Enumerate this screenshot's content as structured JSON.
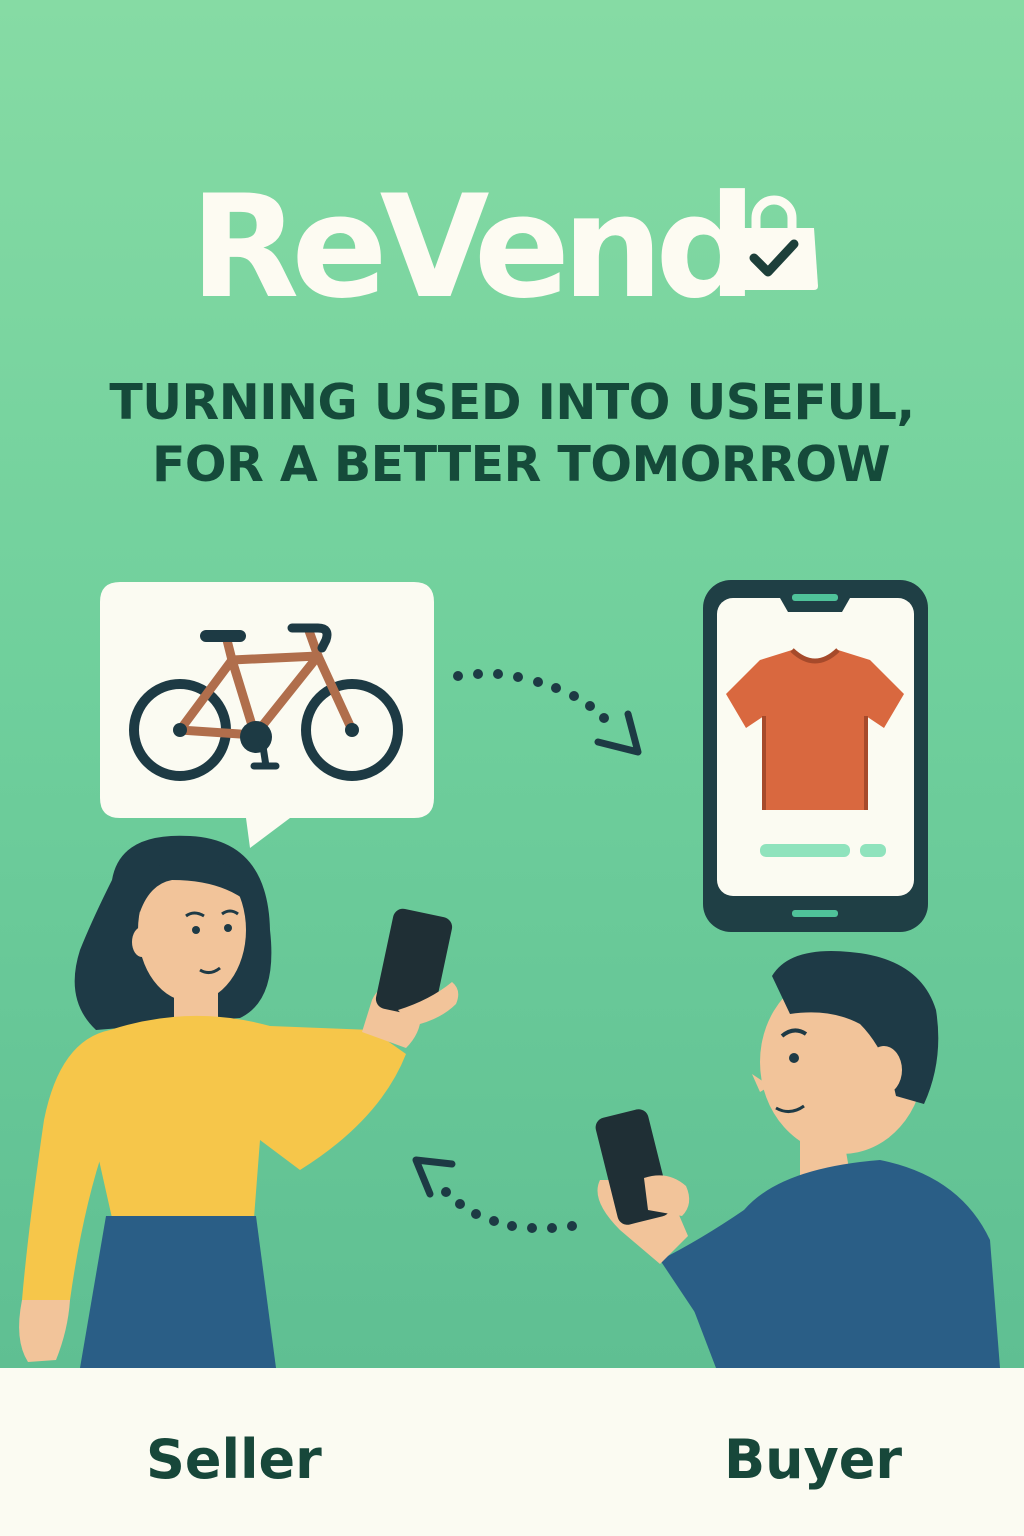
{
  "brand": {
    "name": "ReVend",
    "logo_icon": "shopping-bag-check-icon"
  },
  "tagline": {
    "line1": "TURNING USED INTO USEFUL,",
    "line2": "FOR A BETTER TOMORROW"
  },
  "roles": {
    "seller": "Seller",
    "buyer": "Buyer"
  },
  "items": {
    "seller_item_icon": "bicycle-icon",
    "buyer_item_icon": "t-shirt-icon"
  },
  "colors": {
    "background_top": "#86dba4",
    "background_bottom": "#5bbb90",
    "tagline": "#154a3a",
    "logo": "#fdfbf2",
    "footer": "#fbfbf2"
  }
}
